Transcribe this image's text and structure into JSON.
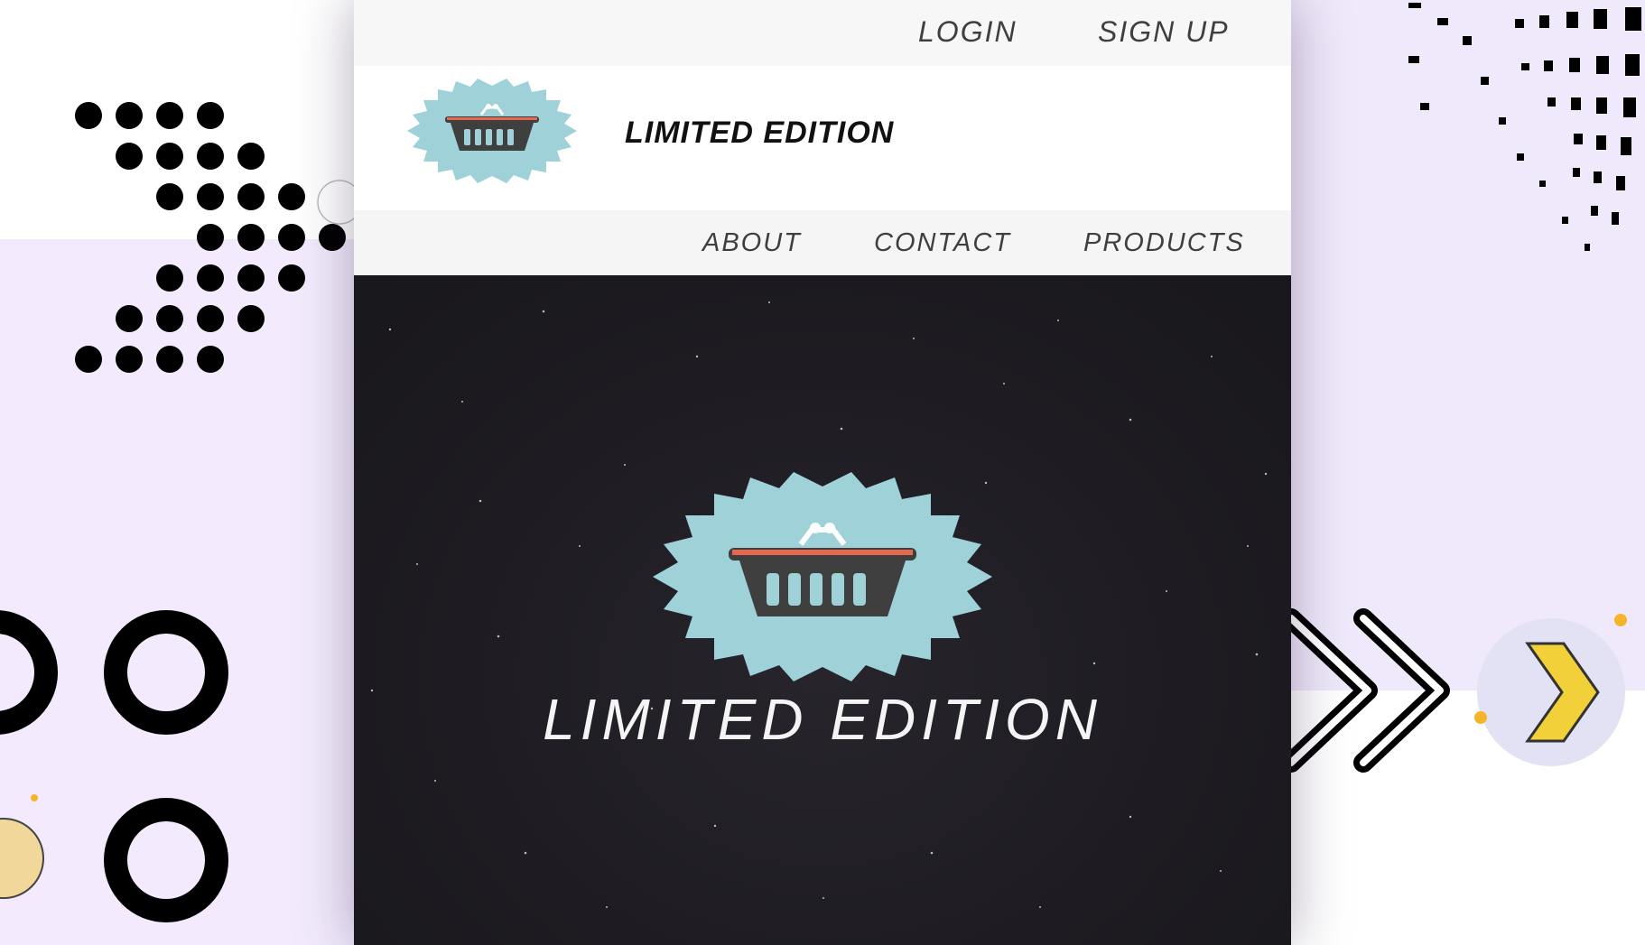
{
  "header": {
    "login_label": "LOGIN",
    "signup_label": "SIGN UP"
  },
  "brand": {
    "title": "LIMITED EDITION",
    "logo_icon": "shopping-basket-icon"
  },
  "nav": {
    "items": [
      {
        "label": "ABOUT"
      },
      {
        "label": "CONTACT"
      },
      {
        "label": "PRODUCTS"
      }
    ]
  },
  "hero": {
    "title": "LIMITED EDITION",
    "logo_icon": "shopping-basket-icon"
  },
  "colors": {
    "badge": "#9fd1d9",
    "basket": "#3f3f3f",
    "basket_rim": "#e8674f",
    "hero_bg": "#1e1c22",
    "lilac": "#f3ebfd"
  }
}
